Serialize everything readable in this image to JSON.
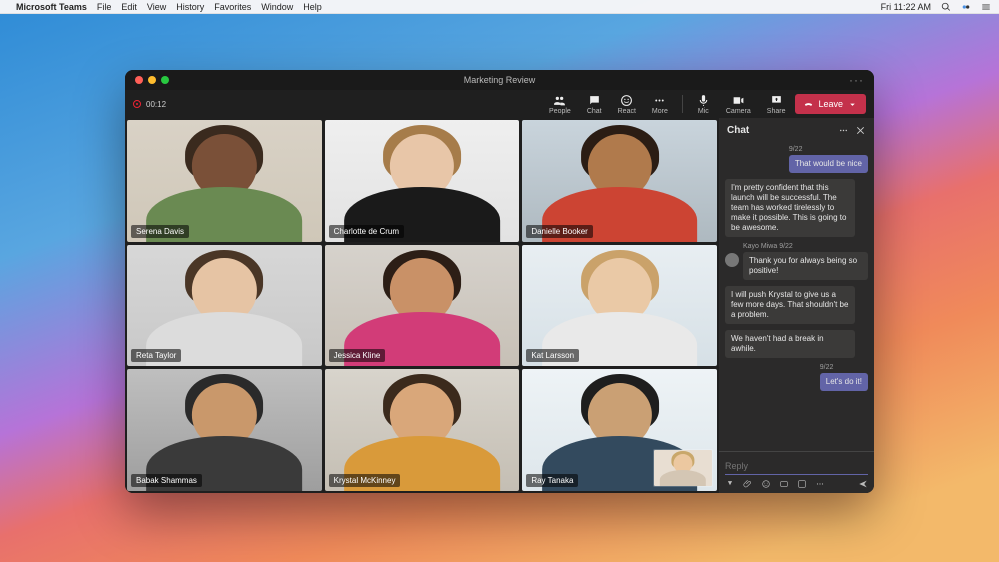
{
  "menubar": {
    "app_name": "Microsoft Teams",
    "items": [
      "File",
      "Edit",
      "View",
      "History",
      "Favorites",
      "Window",
      "Help"
    ],
    "clock": "Fri 11:22 AM"
  },
  "window": {
    "title": "Marketing Review",
    "timer": "00:12",
    "controls": {
      "people": "People",
      "chat": "Chat",
      "react": "React",
      "more": "More",
      "mic": "Mic",
      "camera": "Camera",
      "share": "Share",
      "leave": "Leave"
    }
  },
  "participants": [
    {
      "name": "Serena Davis"
    },
    {
      "name": "Charlotte de Crum"
    },
    {
      "name": "Danielle Booker"
    },
    {
      "name": "Reta Taylor"
    },
    {
      "name": "Jessica Kline"
    },
    {
      "name": "Kat Larsson"
    },
    {
      "name": "Babak Shammas"
    },
    {
      "name": "Krystal McKinney"
    },
    {
      "name": "Ray Tanaka"
    }
  ],
  "chat": {
    "title": "Chat",
    "messages": [
      {
        "type": "me",
        "time": "9/22",
        "text": "That would be nice"
      },
      {
        "type": "other",
        "author": "",
        "time": "",
        "text": "I'm pretty confident that this launch will be successful. The team has worked tirelessly to make it possible. This is going to be awesome."
      },
      {
        "type": "other",
        "author": "Kayo Miwa",
        "time": "9/22",
        "text": "Thank you for always being so positive!"
      },
      {
        "type": "other",
        "author": "",
        "time": "",
        "text": "I will push Krystal to give us a few more days. That shouldn't be a problem."
      },
      {
        "type": "other",
        "author": "",
        "time": "",
        "text": "We haven't had a break in awhile."
      },
      {
        "type": "me",
        "time": "9/22",
        "text": "Let's do it!"
      }
    ],
    "reply_placeholder": "Reply"
  }
}
